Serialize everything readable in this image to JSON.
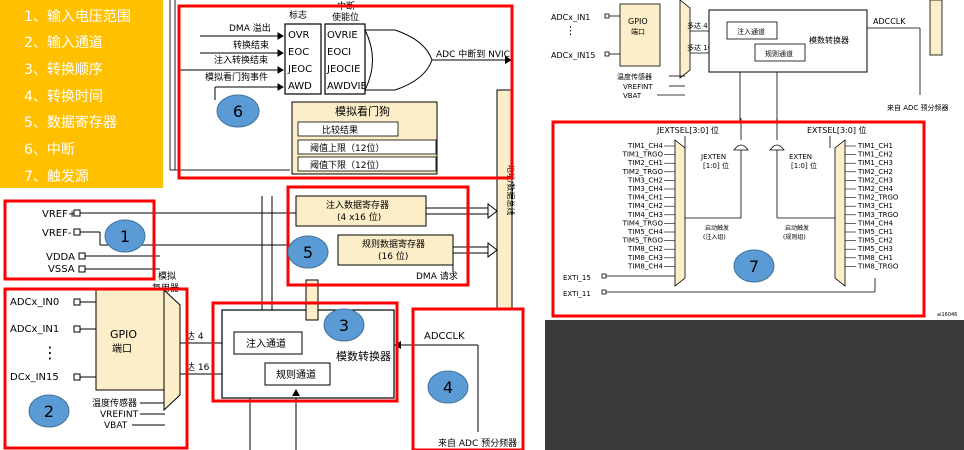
{
  "legend": {
    "items": [
      "1、输入电压范围",
      "2、输入通道",
      "3、转换顺序",
      "4、转换时间",
      "5、数据寄存器",
      "6、中断",
      "7、触发源"
    ]
  },
  "badges": [
    "1",
    "2",
    "3",
    "4",
    "5",
    "6",
    "7"
  ],
  "interrupt": {
    "flag_header": "标志",
    "enable_header_line1": "中断",
    "enable_header_line2": "使能位",
    "events": [
      "DMA 溢出",
      "转换结束",
      "注入转换结束",
      "模拟看门狗事件"
    ],
    "flags": [
      "OVR",
      "EOC",
      "JEOC",
      "AWD"
    ],
    "enables": [
      "OVRIE",
      "EOCI",
      "JEOCIE",
      "AWDVIE"
    ],
    "output": "ADC 中断到 NVIC"
  },
  "watchdog": {
    "title": "模拟看门狗",
    "compare": "比较结果",
    "high": "阈值上限（12位）",
    "low": "阈值下限（12位）"
  },
  "registers": {
    "injected_line1": "注入数据寄存器",
    "injected_line2": "(4 x16 位)",
    "regular_line1": "规则数据寄存器",
    "regular_line2": "(16 位)",
    "dma": "DMA 请求",
    "bus": "地址/数据总线"
  },
  "power": {
    "vref_plus": "VREF+",
    "vref_minus": "VREF-",
    "vdda": "VDDA",
    "vssa": "VSSA",
    "analog_mux_1": "模拟",
    "analog_mux_2": "复用器"
  },
  "inputs": {
    "in0": "ADCx_IN0",
    "in1": "ADCx_IN1",
    "dots": "⋮",
    "in15": "DCx_IN15",
    "gpio_1": "GPIO",
    "gpio_2": "端口",
    "temp": "温度传感器",
    "vrefint": "VREFINT",
    "vbat": "VBAT"
  },
  "converter": {
    "injected": "注入通道",
    "regular": "规则通道",
    "name": "模数转换器",
    "upto4": "达 4",
    "upto16": "达 16"
  },
  "clock": {
    "adcclk": "ADCCLK",
    "prescaler": "来自 ADC 预分频器"
  },
  "right_top": {
    "in1": "ADCx_IN1",
    "in15": "ADCx_IN15",
    "gpio_1": "GPIO",
    "gpio_2": "端口",
    "upto4": "多达 4",
    "upto16": "多达 16",
    "injected": "注入通道",
    "regular": "规则通道",
    "name": "模数转换器",
    "adcclk": "ADCCLK",
    "temp": "温度传感器",
    "vrefint": "VREFINT",
    "vbat": "VBAT",
    "prescaler": "来自 ADC 预分频器"
  },
  "triggers": {
    "jextsel": "JEXTSEL[3:0] 位",
    "extsel": "EXTSEL[3:0] 位",
    "jexten": "JEXTEN",
    "jexten_bits": "[1:0] 位",
    "exten": "EXTEN",
    "exten_bits": "[1:0] 位",
    "inj_trigger_1": "启动触发",
    "inj_trigger_2": "(注入组)",
    "reg_trigger_1": "启动触发",
    "reg_trigger_2": "(规则组)",
    "injected_sources": [
      "TIM1_CH4",
      "TIM1_TRGO",
      "TIM2_CH1",
      "TIM2_TRGO",
      "TIM3_CH2",
      "TIM3_CH4",
      "TIM4_CH1",
      "TIM4_CH2",
      "TIM4_CH3",
      "TIM4_TRGO",
      "TIM5_CH4",
      "TIM5_TRGO",
      "TIM8_CH2",
      "TIM8_CH3",
      "TIM8_CH4"
    ],
    "regular_sources": [
      "TIM1_CH1",
      "TIM1_CH2",
      "TIM1_CH3",
      "TIM2_CH2",
      "TIM2_CH3",
      "TIM2_CH4",
      "TIM2_TRGO",
      "TIM3_CH1",
      "TIM3_TRGO",
      "TIM4_CH4",
      "TIM5_CH1",
      "TIM5_CH2",
      "TIM5_CH3",
      "TIM8_CH1",
      "TIM8_TRGO"
    ],
    "exti15": "EXTI_15",
    "exti11": "EXTI_11",
    "figure_id": "ai16046"
  }
}
